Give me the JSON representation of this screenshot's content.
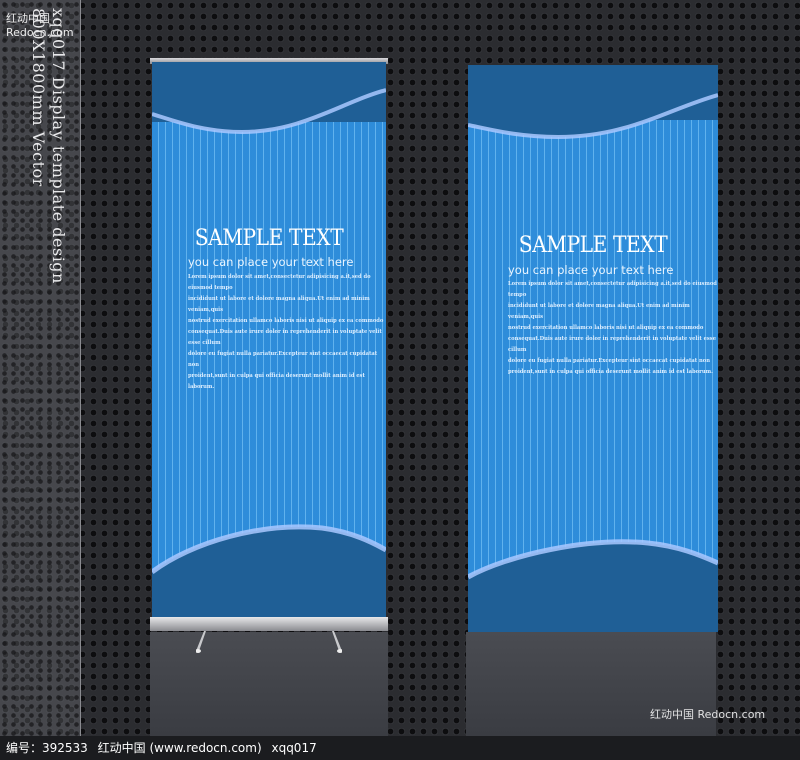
{
  "site_label": "红动中国 Redocn.com",
  "vertical_title": {
    "line1": "xqq017 Display template design",
    "line2": "800X1800mm Vector"
  },
  "banner_left": {
    "headline": "SAMPLE TEXT",
    "tagline": "you can place your text here",
    "body": [
      "Lorem ipsum dolor sit amet,consectetur adipisicing a.it,sed do eiusmod tempo",
      "incididunt ut labore et dolore magna aliqua.Ut enim ad minim veniam,quis",
      "nostrud exercitation ullamco laboris nisi ut aliquip ex ea commodo",
      "consequat.Duis aute irure dolor in reprehenderit in voluptate velit esse cillum",
      "dolore eu fugiat nulla pariatur.Excepteur sint occaecat cupidatat non",
      "proident,sunt in culpa qui officia deserunt mollit anim id est laborum."
    ]
  },
  "banner_right": {
    "headline": "SAMPLE TEXT",
    "tagline": "you can place your text here",
    "body": [
      "Lorem ipsum dolor sit amet,consectetur adipisicing a.it,sed do eiusmod tempo",
      "incididunt ut labore et dolore magna aliqua.Ut enim ad minim veniam,quis",
      "nostrud exercitation ullamco laboris nisi ut aliquip ex ea commodo",
      "consequat.Duis aute irure dolor in reprehenderit in voluptate velit esse cillum",
      "dolore eu fugiat nulla pariatur.Excepteur sint occaecat cupidatat non",
      "proident,sunt in culpa qui officia deserunt mollit anim id est laborum."
    ]
  },
  "watermark": "红动中国 Redocn.com",
  "bottom_bar": {
    "id_text": "编号：392533",
    "site_text": "红动中国 (www.redocn.com)",
    "code": "xqq017"
  },
  "colors": {
    "banner_dark": "#1f5f96",
    "stripe_blue": "#2f8fdd",
    "wave_highlight": "#a9c8ff"
  }
}
